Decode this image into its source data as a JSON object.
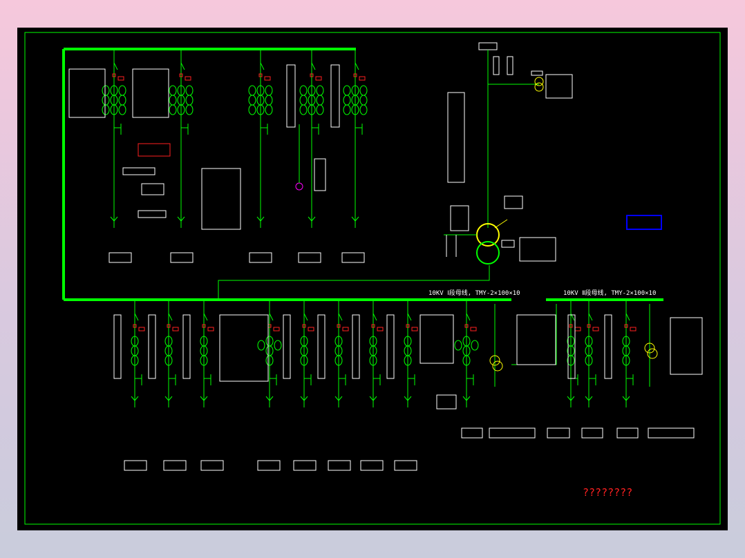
{
  "colors": {
    "background": "#000000",
    "frame": "#00ff00",
    "wire": "#00ff00",
    "bus": "#00ff00",
    "text": "#ffffff",
    "label": "#ff2020",
    "accent": "#ff00ff",
    "transformer": "#ffff00",
    "note_box": "#0000ff"
  },
  "busbars": {
    "section_one_label": "10KV Ⅰ段母线, TMY-2×100×10",
    "section_two_label": "10KV Ⅱ段母线, TMY-2×100×10"
  },
  "title_block": {
    "caption": "????????"
  }
}
